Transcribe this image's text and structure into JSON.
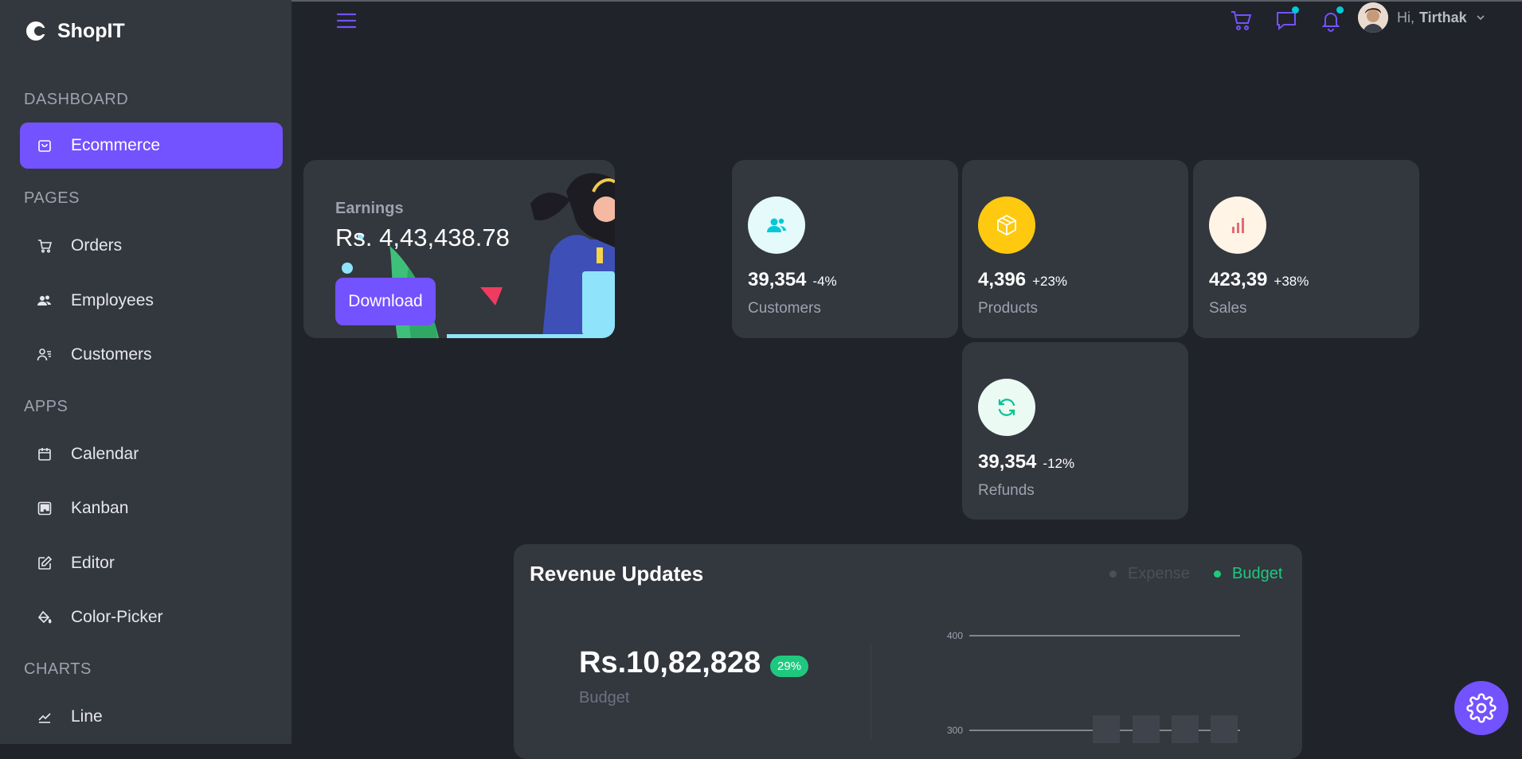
{
  "app": {
    "brand": "ShopIT"
  },
  "sidebar": {
    "sections": [
      {
        "title": "DASHBOARD",
        "items": [
          {
            "label": "Ecommerce",
            "icon": "shopping-bag-icon",
            "active": true
          }
        ]
      },
      {
        "title": "PAGES",
        "items": [
          {
            "label": "Orders",
            "icon": "cart-icon"
          },
          {
            "label": "Employees",
            "icon": "employees-icon"
          },
          {
            "label": "Customers",
            "icon": "customers-icon"
          }
        ]
      },
      {
        "title": "APPS",
        "items": [
          {
            "label": "Calendar",
            "icon": "calendar-icon"
          },
          {
            "label": "Kanban",
            "icon": "kanban-icon"
          },
          {
            "label": "Editor",
            "icon": "edit-icon"
          },
          {
            "label": "Color-Picker",
            "icon": "paint-bucket-icon"
          }
        ]
      },
      {
        "title": "CHARTS",
        "items": [
          {
            "label": "Line",
            "icon": "line-chart-icon"
          }
        ]
      }
    ]
  },
  "header": {
    "greeting": "Hi,",
    "user_name": "Tirthak"
  },
  "earnings": {
    "title": "Earnings",
    "value": "Rs. 4,43,438.78",
    "button_label": "Download"
  },
  "stats": [
    {
      "value": "39,354",
      "percent": "-4%",
      "label": "Customers",
      "icon": "customers-icon",
      "icon_color": "#03c9d7",
      "icon_bg": "#e5fafb",
      "percent_color": "#ffffff"
    },
    {
      "value": "4,396",
      "percent": "+23%",
      "label": "Products",
      "icon": "box-icon",
      "icon_color": "#ffffff",
      "icon_bg": "#fec90f",
      "percent_color": "#ffffff"
    },
    {
      "value": "423,39",
      "percent": "+38%",
      "label": "Sales",
      "icon": "bar-chart-icon",
      "icon_color": "#e46a76",
      "icon_bg": "#fff4e5",
      "percent_color": "#ffffff"
    },
    {
      "value": "39,354",
      "percent": "-12%",
      "label": "Refunds",
      "icon": "refresh-icon",
      "icon_color": "#00c292",
      "icon_bg": "#ebfaf2",
      "percent_color": "#ffffff"
    }
  ],
  "revenue": {
    "title": "Revenue Updates",
    "legend": [
      {
        "label": "Expense",
        "color": "#4b5058"
      },
      {
        "label": "Budget",
        "color": "#1ec97f"
      }
    ],
    "budget_value": "Rs.10,82,828",
    "budget_badge": "29%",
    "budget_label": "Budget",
    "axis_ticks": [
      "400",
      "300"
    ]
  },
  "colors": {
    "accent": "#7352ff",
    "sidebar_bg": "#33373e",
    "main_bg": "#20232a"
  }
}
